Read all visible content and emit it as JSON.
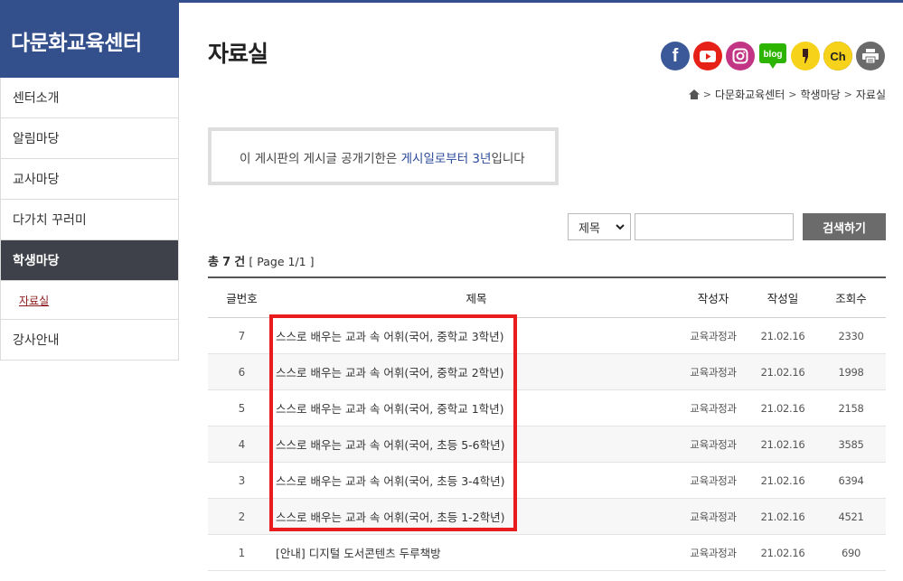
{
  "sidebar": {
    "title": "다문화교육센터",
    "items": [
      {
        "label": "센터소개"
      },
      {
        "label": "알림마당"
      },
      {
        "label": "교사마당"
      },
      {
        "label": "다가치 꾸러미"
      },
      {
        "label": "학생마당"
      },
      {
        "label": "자료실"
      },
      {
        "label": "강사안내"
      }
    ]
  },
  "page": {
    "title": "자료실"
  },
  "social": [
    {
      "name": "facebook-icon",
      "glyph": "f",
      "color": "#3b5998"
    },
    {
      "name": "youtube-icon",
      "glyph": "▶",
      "color": "#e62117"
    },
    {
      "name": "instagram-icon",
      "glyph": "◎",
      "color": "#c13584"
    },
    {
      "name": "blog-icon",
      "glyph": "blog",
      "color": "#2db400"
    },
    {
      "name": "kakaostory-icon",
      "glyph": "❙",
      "color": "#f7d21a"
    },
    {
      "name": "kakao-channel-icon",
      "glyph": "Ch",
      "color": "#222222"
    },
    {
      "name": "print-icon",
      "glyph": "▤",
      "color": "#6b6b6b"
    }
  ],
  "breadcrumb": [
    "다문화교육센터",
    "학생마당",
    "자료실"
  ],
  "notice": {
    "prefix": "이 게시판의 게시글 공개기한은 ",
    "highlight": "게시일로부터 3년",
    "suffix": "입니다"
  },
  "search": {
    "field": "제목",
    "button": "검색하기"
  },
  "count": {
    "label": "총",
    "num": "7",
    "unit": "건",
    "page": "[ Page 1/1 ]"
  },
  "table": {
    "headers": [
      "글번호",
      "제목",
      "작성자",
      "작성일",
      "조회수"
    ],
    "rows": [
      {
        "no": "7",
        "title": "스스로 배우는 교과 속 어휘(국어, 중학교 3학년)",
        "author": "교육과정과",
        "date": "21.02.16",
        "views": "2330"
      },
      {
        "no": "6",
        "title": "스스로 배우는 교과 속 어휘(국어, 중학교 2학년)",
        "author": "교육과정과",
        "date": "21.02.16",
        "views": "1998"
      },
      {
        "no": "5",
        "title": "스스로 배우는 교과 속 어휘(국어, 중학교 1학년)",
        "author": "교육과정과",
        "date": "21.02.16",
        "views": "2158"
      },
      {
        "no": "4",
        "title": "스스로 배우는 교과 속 어휘(국어, 초등 5-6학년)",
        "author": "교육과정과",
        "date": "21.02.16",
        "views": "3585"
      },
      {
        "no": "3",
        "title": "스스로 배우는 교과 속 어휘(국어, 초등 3-4학년)",
        "author": "교육과정과",
        "date": "21.02.16",
        "views": "6394"
      },
      {
        "no": "2",
        "title": "스스로 배우는 교과 속 어휘(국어, 초등 1-2학년)",
        "author": "교육과정과",
        "date": "21.02.16",
        "views": "4521"
      },
      {
        "no": "1",
        "title": "[안내] 디지털 도서콘텐츠 두루책방",
        "author": "교육과정과",
        "date": "21.02.16",
        "views": "690"
      }
    ]
  },
  "colors": {
    "brand": "#34508c",
    "active_menu": "#3e4149",
    "highlight_box": "#e81c1c"
  }
}
